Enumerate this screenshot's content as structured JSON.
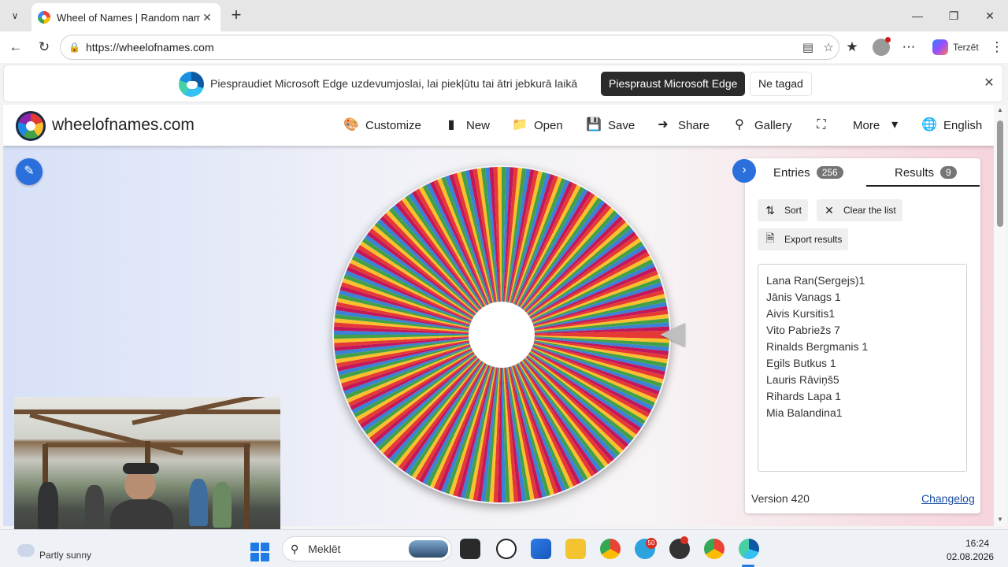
{
  "browser": {
    "tab_title": "Wheel of Names | Random name pi",
    "url": "https://wheelofnames.com",
    "copilot_label": "Terzēt"
  },
  "notification": {
    "message": "Piespraudiet Microsoft Edge uzdevumjoslai, lai piekļūtu tai ātri jebkurā laikā",
    "pin_button": "Piespraust Microsoft Edge",
    "not_now_button": "Ne tagad"
  },
  "site": {
    "name": "wheelofnames.com",
    "nav": {
      "customize": "Customize",
      "new": "New",
      "open": "Open",
      "save": "Save",
      "share": "Share",
      "gallery": "Gallery",
      "more": "More",
      "language": "English"
    }
  },
  "wheel": {
    "colors": [
      "#e53935",
      "#fbc02d",
      "#43a047",
      "#3b82d6",
      "#c2185b"
    ]
  },
  "panel": {
    "tabs": {
      "entries_label": "Entries",
      "entries_count": "256",
      "results_label": "Results",
      "results_count": "9"
    },
    "buttons": {
      "sort": "Sort",
      "clear": "Clear the list",
      "export": "Export results"
    },
    "results": [
      "Lana Ran(Sergejs)1",
      "Jānis Vanags 1",
      "Aivis Kursitis1",
      "Vito Pabriežs 7",
      "Rinalds Bergmanis 1",
      "Egils Butkus 1",
      "Lauris Rāviņš5",
      "Rihards Lapa 1",
      "Mia Balandina1"
    ],
    "version": "Version 420",
    "changelog": "Changelog"
  },
  "taskbar": {
    "weather": "Partly sunny",
    "search_label": "Meklēt",
    "telegram_badge": "50",
    "time": "16:24",
    "date": "02.08.2026"
  }
}
